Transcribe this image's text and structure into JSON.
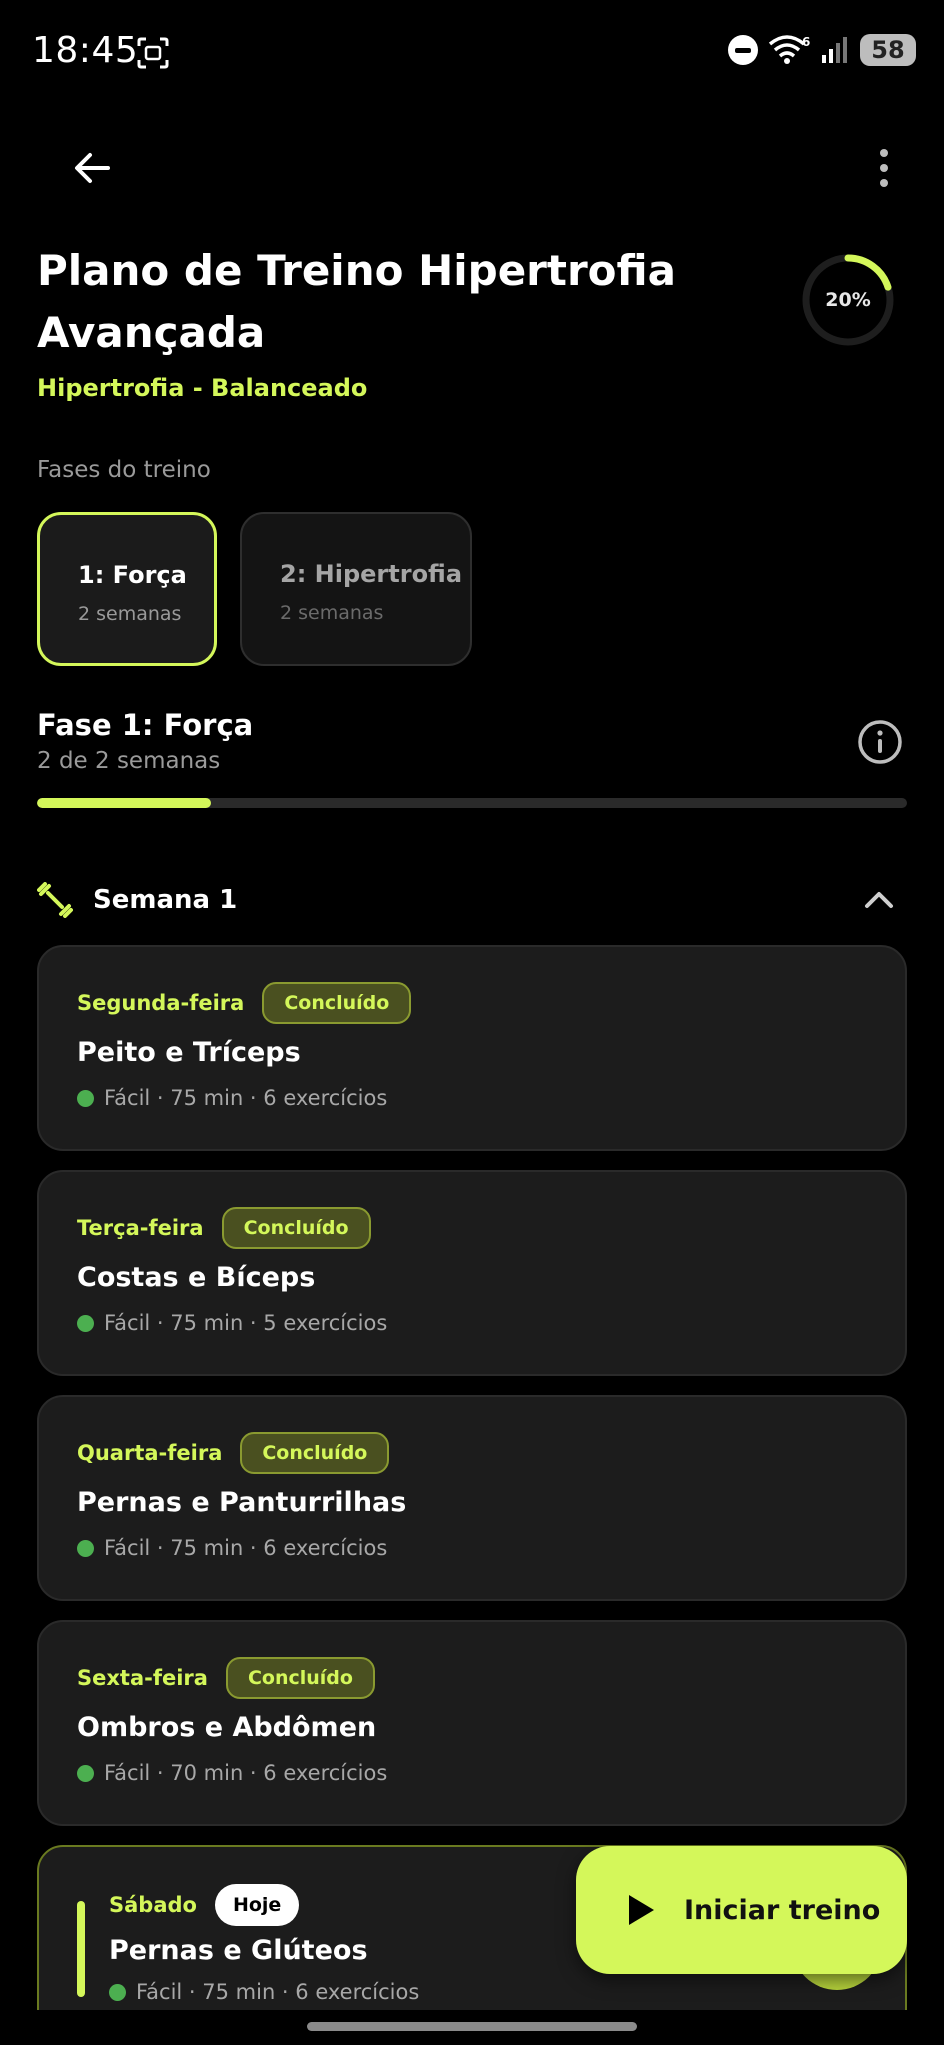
{
  "status_bar": {
    "time": "18:45",
    "battery": "58",
    "signal_label": "6"
  },
  "header": {
    "title": "Plano de Treino Hipertrofia Avançada",
    "subtitle": "Hipertrofia - Balanceado",
    "progress_label": "20%",
    "progress_value": 0.2
  },
  "phases": {
    "label": "Fases do treino",
    "items": [
      {
        "name": "1: Força",
        "weeks": "2 semanas",
        "active": true
      },
      {
        "name": "2: Hipertrofia",
        "weeks": "2 semanas",
        "active": false
      }
    ]
  },
  "current_phase": {
    "title": "Fase 1: Força",
    "subtitle": "2 de 2 semanas",
    "progress": 0.2
  },
  "week": {
    "title": "Semana 1"
  },
  "days": [
    {
      "day": "Segunda-feira",
      "badge": "Concluído",
      "title": "Peito e Tríceps",
      "meta": "Fácil · 75 min · 6 exercícios"
    },
    {
      "day": "Terça-feira",
      "badge": "Concluído",
      "title": "Costas e Bíceps",
      "meta": "Fácil · 75 min · 5 exercícios"
    },
    {
      "day": "Quarta-feira",
      "badge": "Concluído",
      "title": "Pernas e Panturrilhas",
      "meta": "Fácil · 75 min · 6 exercícios"
    },
    {
      "day": "Sexta-feira",
      "badge": "Concluído",
      "title": "Ombros e Abdômen",
      "meta": "Fácil · 70 min · 6 exercícios"
    }
  ],
  "today": {
    "day": "Sábado",
    "badge": "Hoje",
    "title": "Pernas e Glúteos",
    "meta": "Fácil · 75 min · 6 exercícios"
  },
  "fab": {
    "label": "Iniciar treino"
  },
  "colors": {
    "accent": "#d4f75a",
    "easy": "#4caf50",
    "background": "#000000",
    "card": "#1c1c1c"
  }
}
